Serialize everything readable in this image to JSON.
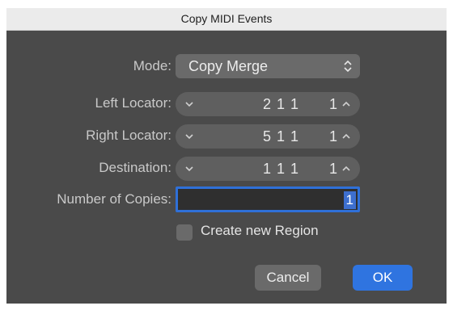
{
  "dialog": {
    "title": "Copy MIDI Events",
    "mode": {
      "label": "Mode:",
      "value": "Copy Merge",
      "icon": "up-down-chevron-icon"
    },
    "left_locator": {
      "label": "Left Locator:",
      "bars": "2 1 1",
      "units": "1"
    },
    "right_locator": {
      "label": "Right Locator:",
      "bars": "5 1 1",
      "units": "1"
    },
    "destination": {
      "label": "Destination:",
      "bars": "1 1 1",
      "units": "1"
    },
    "number_of_copies": {
      "label": "Number of Copies:",
      "value": "1"
    },
    "create_new_region": {
      "label": "Create new Region",
      "checked": false
    },
    "buttons": {
      "cancel": "Cancel",
      "ok": "OK"
    },
    "colors": {
      "accent": "#2f74e0",
      "background": "#4a4a4a",
      "control": "#6a6a6a"
    }
  }
}
